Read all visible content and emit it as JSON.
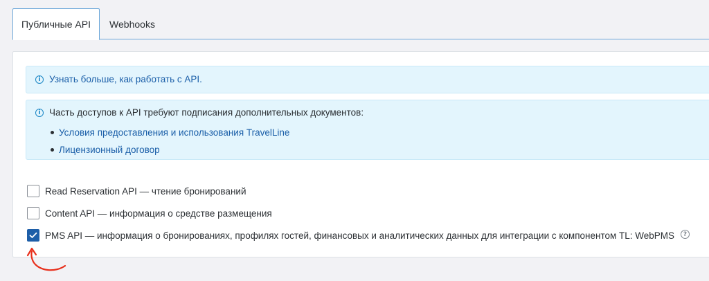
{
  "tabs": [
    {
      "label": "Публичные API",
      "active": true
    },
    {
      "label": "Webhooks",
      "active": false
    }
  ],
  "alerts": {
    "learn_more": "Узнать больше, как работать с API.",
    "docs_intro": "Часть доступов к API требуют подписания дополнительных документов:",
    "docs": [
      "Условия предоставления и использования TravelLine",
      "Лицензионный договор"
    ]
  },
  "permissions": [
    {
      "label": "Read Reservation API — чтение бронирований",
      "checked": false
    },
    {
      "label": "Content API — информация о средстве размещения",
      "checked": false
    },
    {
      "label": "PMS API — информация о бронированиях, профилях гостей, финансовых и аналитических данных для интеграции с компонентом TL: WebPMS",
      "checked": true
    }
  ],
  "icons": {
    "info": "info-circle-icon",
    "help": "question-circle-icon",
    "check": "checkmark-icon",
    "annotation": "curved-arrow-icon"
  },
  "colors": {
    "accent": "#1d5ea8",
    "link": "#1a5ea8",
    "alert_bg": "#e3f5fd",
    "annotation": "#e8301c"
  }
}
